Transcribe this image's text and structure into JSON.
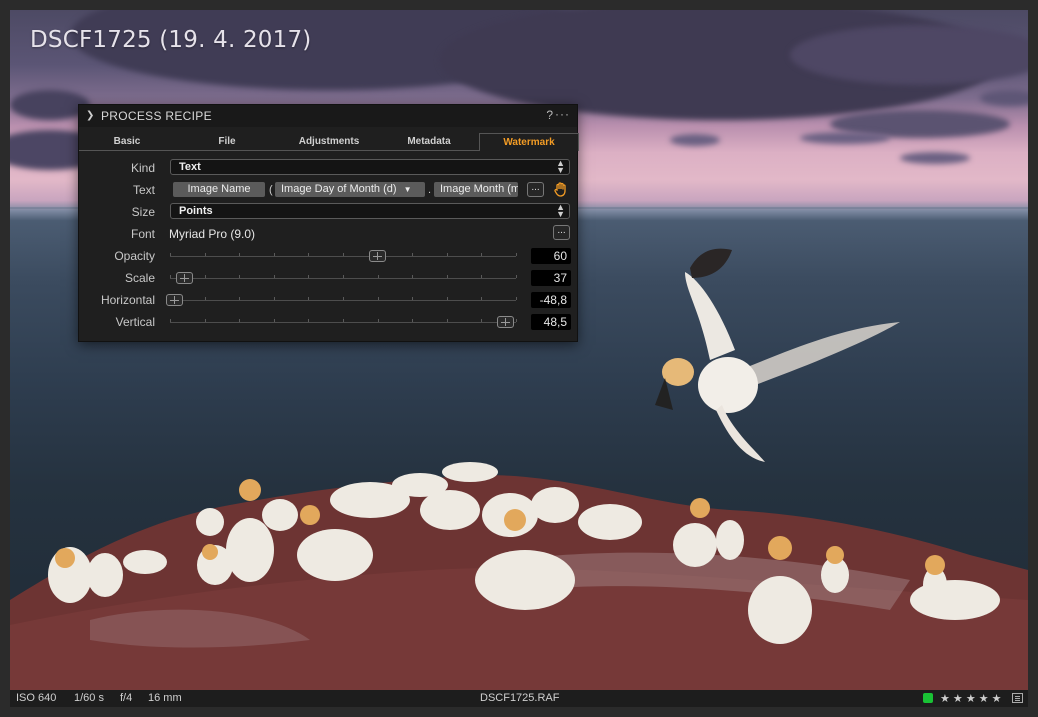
{
  "photo": {
    "title": "DSCF1725 (19. 4. 2017)",
    "description_icon": "photo-of-gannets-on-cliff"
  },
  "panel": {
    "title": "PROCESS RECIPE",
    "help": "?",
    "more": "···",
    "tabs": [
      {
        "label": "Basic",
        "active": false
      },
      {
        "label": "File",
        "active": false
      },
      {
        "label": "Adjustments",
        "active": false
      },
      {
        "label": "Metadata",
        "active": false
      },
      {
        "label": "Watermark",
        "active": true
      }
    ],
    "kind": {
      "label": "Kind",
      "value": "Text"
    },
    "text": {
      "label": "Text",
      "tokens": [
        "Image Name",
        "Image Day of Month (d)",
        "Image Month (m)"
      ],
      "separators": [
        "(",
        "."
      ],
      "more_button": "..."
    },
    "size": {
      "label": "Size",
      "value": "Points"
    },
    "font": {
      "label": "Font",
      "value": "Myriad Pro (9.0)",
      "more_button": "..."
    },
    "sliders": [
      {
        "label": "Opacity",
        "value": "60",
        "position": 0.6
      },
      {
        "label": "Scale",
        "value": "37",
        "position": 0.03
      },
      {
        "label": "Horizontal",
        "value": "-48,8",
        "position": 0.0
      },
      {
        "label": "Vertical",
        "value": "48,5",
        "position": 0.98
      }
    ]
  },
  "statusbar": {
    "iso": "ISO 640",
    "shutter": "1/60 s",
    "aperture": "f/4",
    "focal": "16 mm",
    "filename": "DSCF1725.RAF",
    "color_tag": "#19c235",
    "rating": 0,
    "stars": "★ ★ ★ ★ ★"
  },
  "colors": {
    "accent": "#f39c25",
    "panel_bg": "#1f1f1f"
  }
}
